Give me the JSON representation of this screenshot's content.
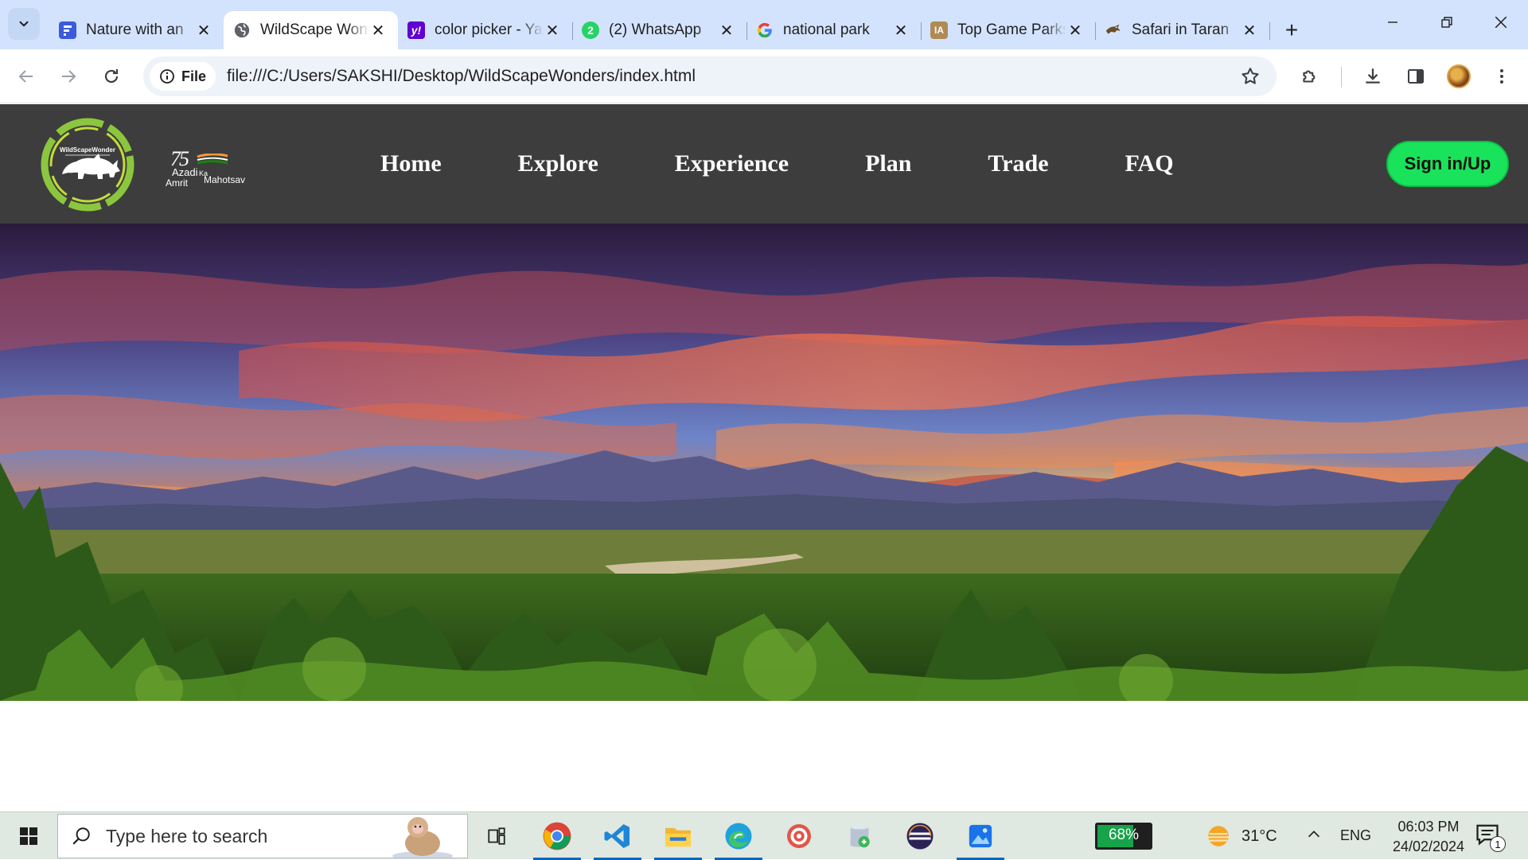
{
  "browser": {
    "tabs": [
      {
        "title": "Nature with an",
        "favicon": "forms-icon",
        "color": "#3b5bdb"
      },
      {
        "title": "WildScape Wonders",
        "favicon": "globe-icon",
        "color": "#5f6368",
        "active": true
      },
      {
        "title": "color picker - Yahoo",
        "favicon": "yahoo-icon",
        "color": "#6001d2"
      },
      {
        "title": "(2) WhatsApp",
        "favicon": "whatsapp-icon",
        "color": "#25d366"
      },
      {
        "title": "national park",
        "favicon": "google-icon",
        "color": "#4285f4"
      },
      {
        "title": "Top Game Parks",
        "favicon": "ia-icon",
        "color": "#b08a55"
      },
      {
        "title": "Safari in Taran",
        "favicon": "safari-icon",
        "color": "#6b4f2a"
      }
    ],
    "favicon_labels": {
      "whatsapp": "2",
      "ia": "IA"
    },
    "site_chip_label": "File",
    "url": "file:///C:/Users/SAKSHI/Desktop/WildScapeWonders/index.html"
  },
  "site": {
    "logo_text": "WildScapeWonder",
    "azadi": {
      "number": "75",
      "line1": "Azadi",
      "ka": "Ka",
      "line2": "Amrit",
      "line3": "Mahotsav"
    },
    "nav": [
      "Home",
      "Explore",
      "Experience",
      "Plan",
      "Trade",
      "FAQ"
    ],
    "signin_label": "Sign in/Up",
    "accent_color": "#19e35a",
    "header_color": "#3d3d3d"
  },
  "taskbar": {
    "search_placeholder": "Type here to search",
    "battery_percent": 68,
    "battery_label": "68%",
    "temperature": "31°C",
    "language": "ENG",
    "time": "06:03 PM",
    "date": "24/02/2024",
    "notification_count": "1"
  }
}
